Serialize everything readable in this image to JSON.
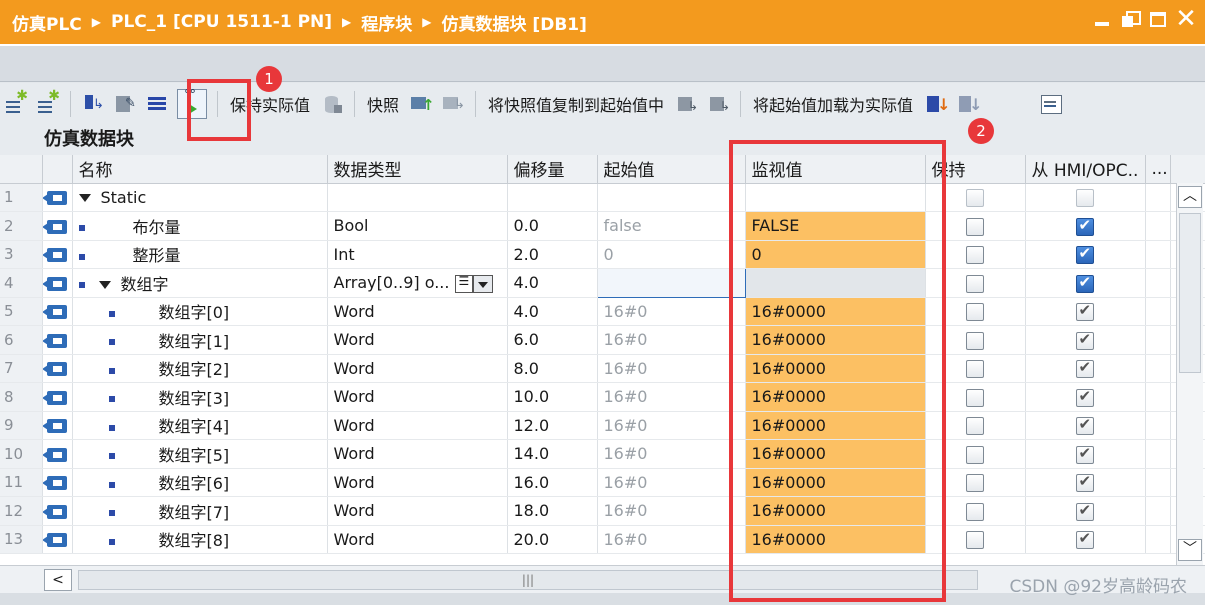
{
  "breadcrumb": [
    "仿真PLC",
    "PLC_1 [CPU 1511-1 PN]",
    "程序块",
    "仿真数据块 [DB1]"
  ],
  "toolbar": {
    "keep_actual": "保持实际值",
    "snapshot": "快照",
    "copy_snapshot": "将快照值复制到起始值中",
    "load_start": "将起始值加载为实际值"
  },
  "panel_title": "仿真数据块",
  "columns": [
    "",
    "名称",
    "数据类型",
    "偏移量",
    "起始值",
    "监视值",
    "保持",
    "从 HMI/OPC..",
    "..."
  ],
  "rows": [
    {
      "num": "1",
      "name": "Static",
      "type": "",
      "offset": "",
      "start": "",
      "monitor": ""
    },
    {
      "num": "2",
      "name": "布尔量",
      "type": "Bool",
      "offset": "0.0",
      "start": "false",
      "monitor": "FALSE"
    },
    {
      "num": "3",
      "name": "整形量",
      "type": "Int",
      "offset": "2.0",
      "start": "0",
      "monitor": "0"
    },
    {
      "num": "4",
      "name": "数组字",
      "type": "Array[0..9] o...",
      "offset": "4.0",
      "start": "",
      "monitor": ""
    },
    {
      "num": "5",
      "name": "数组字[0]",
      "type": "Word",
      "offset": "4.0",
      "start": "16#0",
      "monitor": "16#0000"
    },
    {
      "num": "6",
      "name": "数组字[1]",
      "type": "Word",
      "offset": "6.0",
      "start": "16#0",
      "monitor": "16#0000"
    },
    {
      "num": "7",
      "name": "数组字[2]",
      "type": "Word",
      "offset": "8.0",
      "start": "16#0",
      "monitor": "16#0000"
    },
    {
      "num": "8",
      "name": "数组字[3]",
      "type": "Word",
      "offset": "10.0",
      "start": "16#0",
      "monitor": "16#0000"
    },
    {
      "num": "9",
      "name": "数组字[4]",
      "type": "Word",
      "offset": "12.0",
      "start": "16#0",
      "monitor": "16#0000"
    },
    {
      "num": "10",
      "name": "数组字[5]",
      "type": "Word",
      "offset": "14.0",
      "start": "16#0",
      "monitor": "16#0000"
    },
    {
      "num": "11",
      "name": "数组字[6]",
      "type": "Word",
      "offset": "16.0",
      "start": "16#0",
      "monitor": "16#0000"
    },
    {
      "num": "12",
      "name": "数组字[7]",
      "type": "Word",
      "offset": "18.0",
      "start": "16#0",
      "monitor": "16#0000"
    },
    {
      "num": "13",
      "name": "数组字[8]",
      "type": "Word",
      "offset": "20.0",
      "start": "16#0",
      "monitor": "16#0000"
    }
  ],
  "badges": [
    "1",
    "2"
  ],
  "hscroll_label": "|||",
  "watermark": "CSDN @92岁高龄码农",
  "colors": {
    "title_bar": "#f39a1e",
    "monitor_cell": "#fcc063",
    "annotation_red": "#e8373a"
  }
}
